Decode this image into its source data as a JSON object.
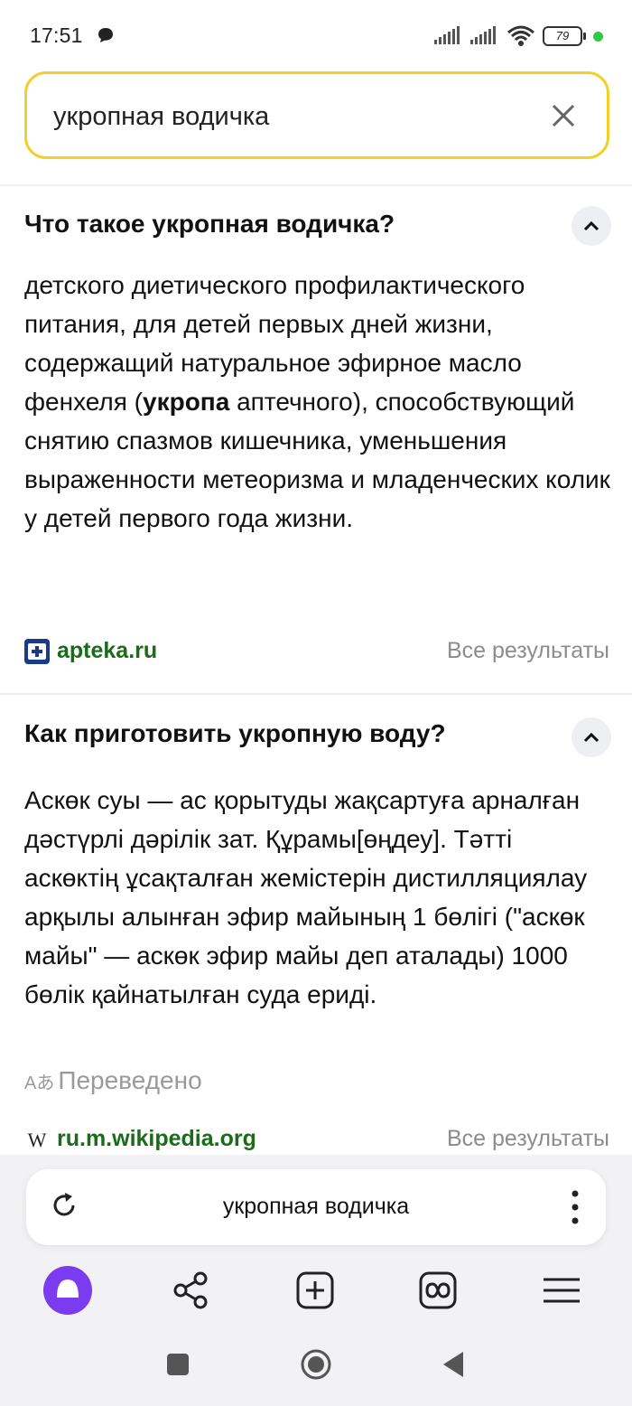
{
  "status_bar": {
    "time": "17:51",
    "battery": "79"
  },
  "search": {
    "query": "укропная водичка"
  },
  "cards": [
    {
      "title": "Что такое укропная водичка?",
      "body_before": "детского диетического профилактического питания, для детей первых дней жизни, содержащий натуральное эфирное масло фенхеля (",
      "body_bold": "укропа",
      "body_after": " аптечного), способствующий снятию спазмов кишечника, уменьшения выраженности метеоризма и младенческих колик у детей первого года жизни.",
      "source": "apteka.ru",
      "source_icon_label": "apteka.ru",
      "all_results": "Все результаты"
    },
    {
      "title": "Как приготовить укропную воду?",
      "body": "Аскөк суы — ас қорытуды жақсартуға арналған дәстүрлі дәрілік зат. Құрамы[өңдеу]. Тәтті аскөктің ұсақталған жемістерін дистилляциялау арқылы алынған эфир майының 1 бөлігі (\"аскөк майы\" — аскөк эфир майы деп аталады) 1000 бөлік қайнатылған суда ериді.",
      "translated_label": "Переведено",
      "source": "ru.m.wikipedia.org",
      "source_icon_label": "W",
      "all_results": "Все результаты"
    }
  ],
  "address_bar": {
    "text": "укропная водичка"
  },
  "colors": {
    "search_border": "#f2d02b",
    "source_green": "#1a6b1a",
    "alice_purple": "#7b3cf0"
  },
  "icons": {
    "toolbar": [
      "alice-icon",
      "share-icon",
      "new-tab-icon",
      "tabs-icon",
      "menu-icon"
    ],
    "nav": [
      "recent-apps-icon",
      "home-icon",
      "back-icon"
    ]
  }
}
